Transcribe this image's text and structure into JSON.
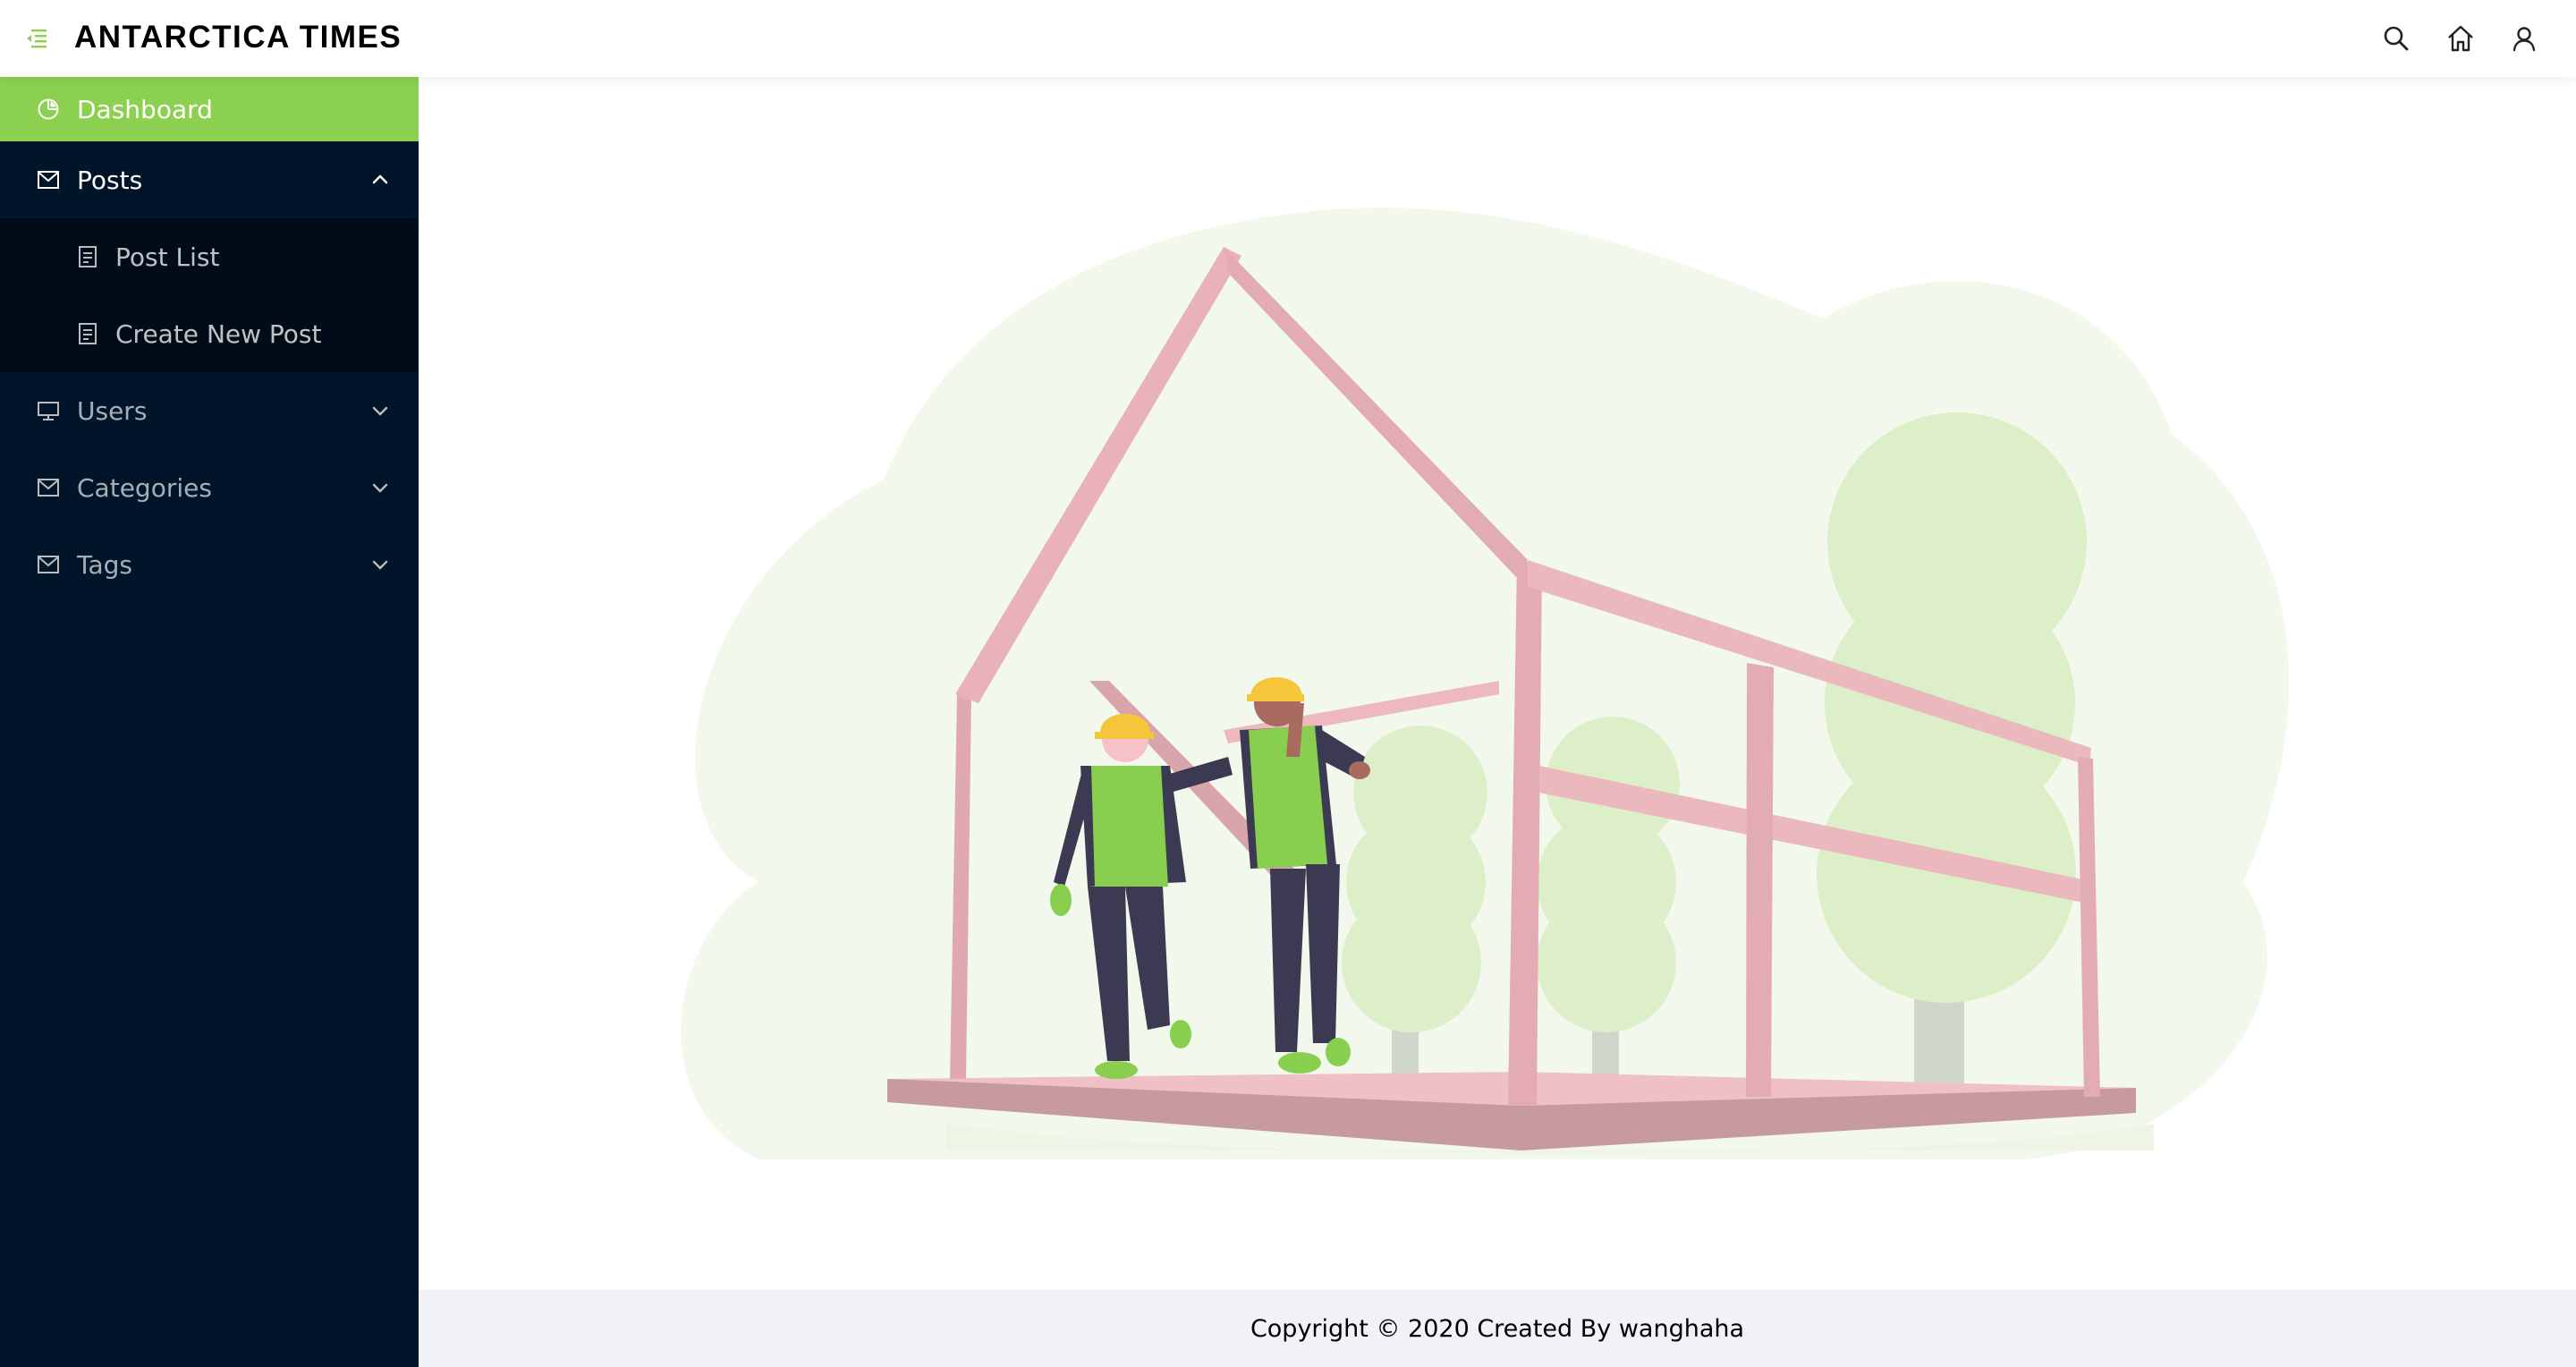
{
  "header": {
    "brand": "ANTARCTICA TIMES",
    "icons": [
      "menu-fold-icon",
      "search-icon",
      "home-icon",
      "user-icon"
    ]
  },
  "sidebar": {
    "items": [
      {
        "label": "Dashboard",
        "icon": "pie-chart-icon",
        "active": true
      },
      {
        "label": "Posts",
        "icon": "mail-icon",
        "expanded": true,
        "children": [
          {
            "label": "Post List",
            "icon": "file-icon"
          },
          {
            "label": "Create New Post",
            "icon": "file-icon"
          }
        ]
      },
      {
        "label": "Users",
        "icon": "desktop-icon",
        "expanded": false
      },
      {
        "label": "Categories",
        "icon": "mail-icon",
        "expanded": false
      },
      {
        "label": "Tags",
        "icon": "mail-icon",
        "expanded": false
      }
    ]
  },
  "main": {
    "illustration": "house-construction-illustration"
  },
  "footer": {
    "text": "Copyright © 2020 Created By wanghaha"
  },
  "colors": {
    "accent": "#8bd14f",
    "sidebar_bg": "#001529",
    "submenu_bg": "#000c17",
    "footer_bg": "#f0f2f5",
    "frame_pink": "#eebcc0",
    "bush_green": "#dcefc9"
  }
}
